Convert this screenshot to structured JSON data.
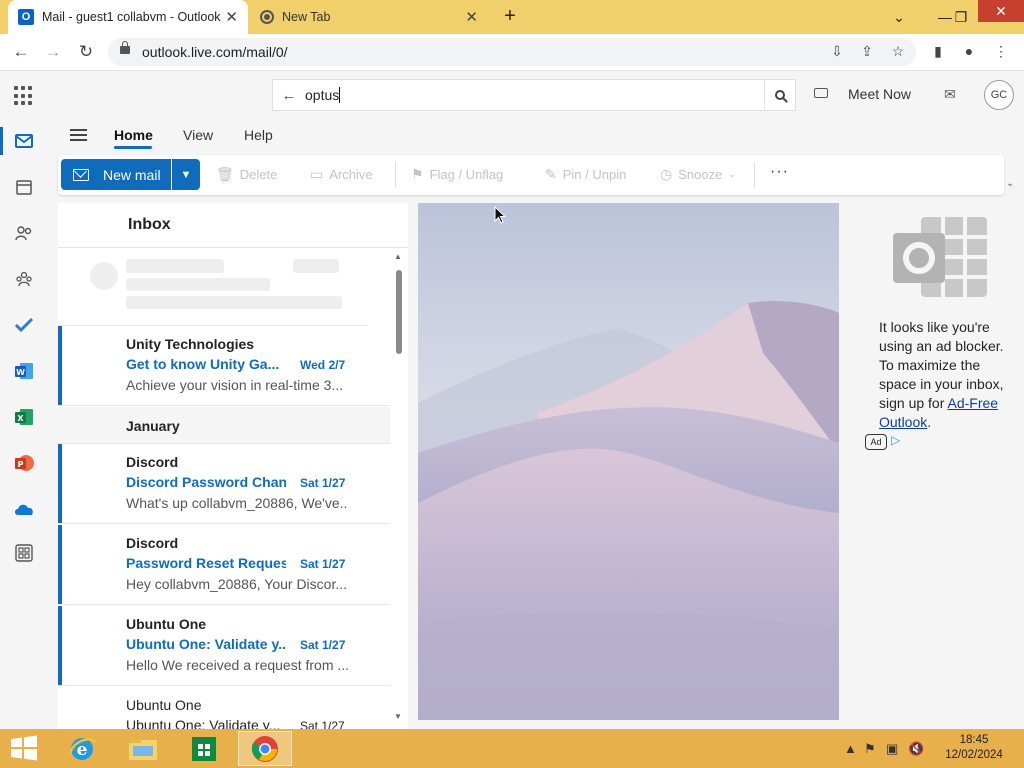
{
  "browser": {
    "tabs": [
      {
        "title": "Mail - guest1 collabvm - Outlook",
        "close": "✕"
      },
      {
        "title": "New Tab",
        "close": "✕"
      }
    ],
    "new_tab": "+",
    "window_controls": {
      "chevron": "⌄",
      "minimize": "—",
      "restore": "❐",
      "close": "✕"
    },
    "url": "outlook.live.com/mail/0/"
  },
  "outlook": {
    "search_value": "optus",
    "meet_now": "Meet Now",
    "avatar_initials": "GC",
    "ribbon_tabs": [
      "Home",
      "View",
      "Help"
    ],
    "new_mail": "New mail",
    "commands": {
      "delete": "Delete",
      "archive": "Archive",
      "flag": "Flag / Unflag",
      "pin": "Pin / Unpin",
      "snooze": "Snooze"
    },
    "more": "···",
    "folder_title": "Inbox",
    "group_label": "January",
    "mails": [
      {
        "sender": "Unity Technologies",
        "subject": "Get to know Unity Ga...",
        "date": "Wed 2/7",
        "preview": "Achieve your vision in real-time 3..."
      },
      {
        "sender": "Discord",
        "subject": "Discord Password Chan...",
        "date": "Sat 1/27",
        "preview": "What's up collabvm_20886, We've..."
      },
      {
        "sender": "Discord",
        "subject": "Password Reset Reques...",
        "date": "Sat 1/27",
        "preview": "Hey collabvm_20886, Your Discor..."
      },
      {
        "sender": "Ubuntu One",
        "subject": "Ubuntu One: Validate y...",
        "date": "Sat 1/27",
        "preview": "Hello We received a request from ..."
      },
      {
        "sender": "Ubuntu One",
        "subject": "Ubuntu One: Validate y...",
        "date": "Sat 1/27",
        "preview": ""
      }
    ],
    "ad": {
      "text_before": "It looks like you're using an ad blocker. To maximize the space in your inbox, sign up for ",
      "link": "Ad-Free Outlook",
      "text_after": ".",
      "badge": "Ad"
    }
  },
  "taskbar": {
    "time": "18:45",
    "date": "12/02/2024"
  },
  "colors": {
    "accent": "#0f6cbd",
    "tabstrip": "#f1cf6b",
    "taskbar": "#e8b04a"
  }
}
